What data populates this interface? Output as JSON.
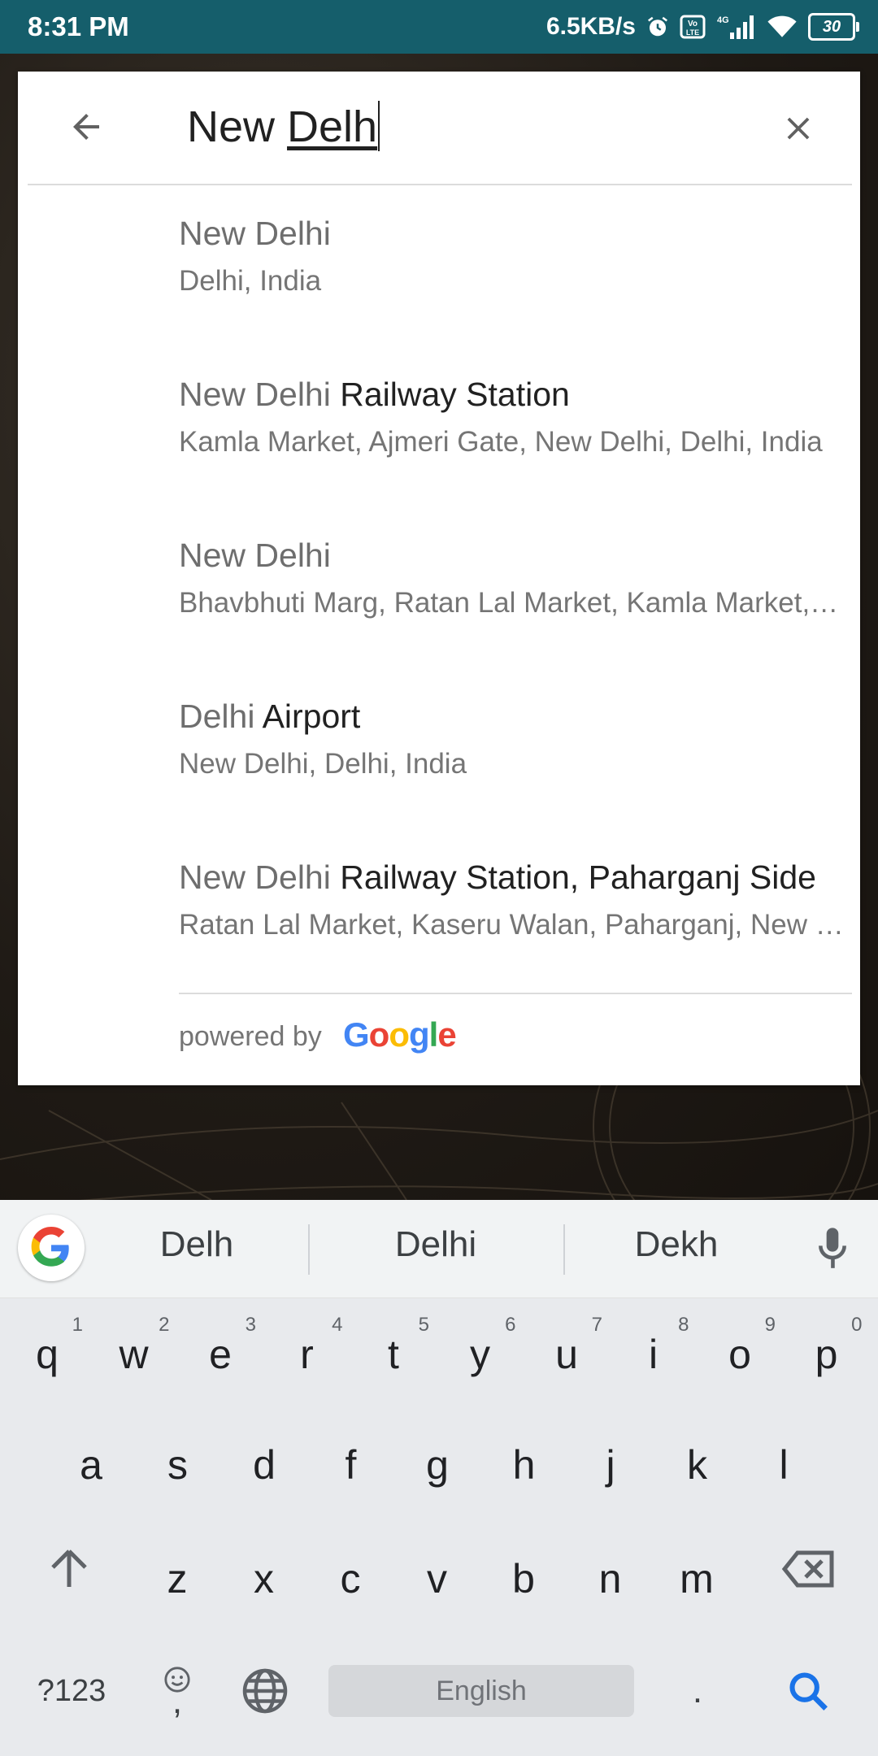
{
  "status_bar": {
    "time": "8:31 PM",
    "speed": "6.5KB/s",
    "battery": "30",
    "icons": [
      "alarm-icon",
      "volte-icon",
      "signal-4g-icon",
      "wifi-icon",
      "battery-icon"
    ]
  },
  "search": {
    "query_prefix": "New ",
    "query_composing": "Delh"
  },
  "results": [
    {
      "match": "New Delhi",
      "rest": "",
      "subtitle": "Delhi, India"
    },
    {
      "match": "New Delhi",
      "rest": " Railway Station",
      "subtitle": "Kamla Market, Ajmeri Gate, New Delhi, Delhi, India"
    },
    {
      "match": "New Delhi",
      "rest": "",
      "subtitle": "Bhavbhuti Marg, Ratan Lal Market, Kamla Market, New Delhi"
    },
    {
      "match": "Delhi",
      "rest": " Airport",
      "subtitle": "New Delhi, Delhi, India"
    },
    {
      "match": "New Delhi",
      "rest": " Railway Station, Paharganj Side",
      "subtitle": "Ratan Lal Market, Kaseru Walan, Paharganj, New Delhi"
    }
  ],
  "footer": {
    "powered_by": "powered by",
    "brand": "Google"
  },
  "keyboard": {
    "suggestions": [
      "Delh",
      "Delhi",
      "Dekh"
    ],
    "row1": [
      {
        "k": "q",
        "h": "1"
      },
      {
        "k": "w",
        "h": "2"
      },
      {
        "k": "e",
        "h": "3"
      },
      {
        "k": "r",
        "h": "4"
      },
      {
        "k": "t",
        "h": "5"
      },
      {
        "k": "y",
        "h": "6"
      },
      {
        "k": "u",
        "h": "7"
      },
      {
        "k": "i",
        "h": "8"
      },
      {
        "k": "o",
        "h": "9"
      },
      {
        "k": "p",
        "h": "0"
      }
    ],
    "row2": [
      "a",
      "s",
      "d",
      "f",
      "g",
      "h",
      "j",
      "k",
      "l"
    ],
    "row3": [
      "z",
      "x",
      "c",
      "v",
      "b",
      "n",
      "m"
    ],
    "symbols_key": "?123",
    "comma_key": ",",
    "space_label": "English",
    "period_key": "."
  },
  "colors": {
    "status_bar": "#155e6b",
    "accent_blue": "#1a73e8",
    "google_blue": "#4285F4",
    "google_red": "#EA4335",
    "google_yellow": "#FBBC05",
    "google_green": "#34A853"
  }
}
